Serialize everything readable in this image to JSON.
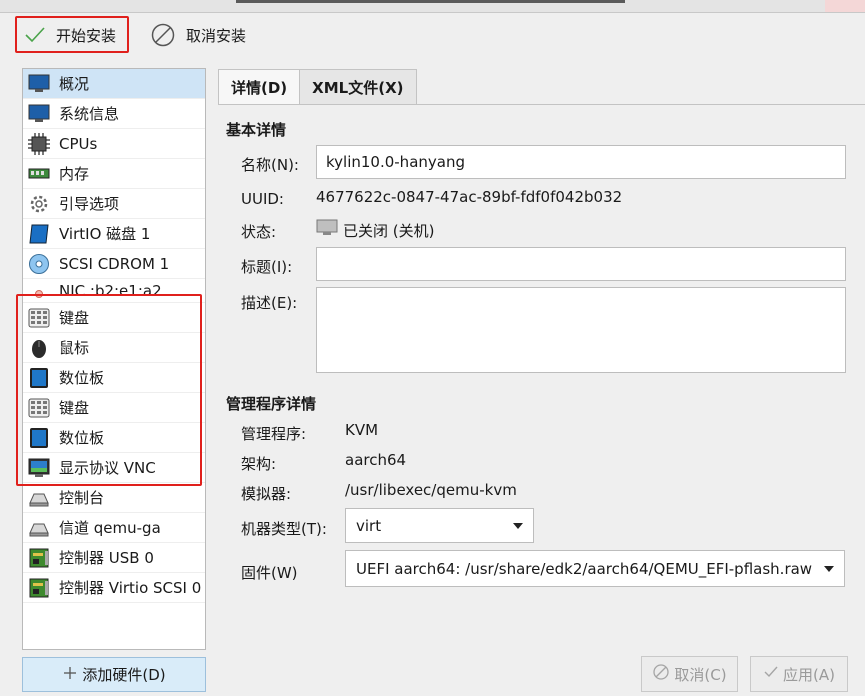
{
  "toolbar": {
    "start_install": "开始安装",
    "cancel_install": "取消安装"
  },
  "sidebar": {
    "items": [
      {
        "label": "概况",
        "icon": "monitor-icon"
      },
      {
        "label": "系统信息",
        "icon": "monitor-icon"
      },
      {
        "label": "CPUs",
        "icon": "cpu-icon"
      },
      {
        "label": "内存",
        "icon": "memory-icon"
      },
      {
        "label": "引导选项",
        "icon": "gear-icon"
      },
      {
        "label": "VirtIO 磁盘 1",
        "icon": "disk-icon"
      },
      {
        "label": "SCSI CDROM 1",
        "icon": "cdrom-icon"
      },
      {
        "label": "NIC :b2:e1:a2",
        "icon": "network-icon"
      },
      {
        "label": "键盘",
        "icon": "keyboard-icon"
      },
      {
        "label": "鼠标",
        "icon": "mouse-icon"
      },
      {
        "label": "数位板",
        "icon": "tablet-icon"
      },
      {
        "label": "键盘",
        "icon": "keyboard-icon"
      },
      {
        "label": "数位板",
        "icon": "tablet-icon"
      },
      {
        "label": "显示协议 VNC",
        "icon": "display-icon"
      },
      {
        "label": "控制台",
        "icon": "console-icon"
      },
      {
        "label": "信道 qemu-ga",
        "icon": "channel-icon"
      },
      {
        "label": "控制器 USB 0",
        "icon": "controller-icon"
      },
      {
        "label": "控制器 Virtio SCSI 0",
        "icon": "controller-icon"
      }
    ],
    "add_hardware": "添加硬件(D)"
  },
  "tabs": [
    {
      "label": "详情(D)"
    },
    {
      "label": "XML文件(X)"
    }
  ],
  "basic": {
    "title": "基本详情",
    "name_label": "名称(N):",
    "name_value": "kylin10.0-hanyang",
    "uuid_label": "UUID:",
    "uuid_value": "4677622c-0847-47ac-89bf-fdf0f042b032",
    "status_label": "状态:",
    "status_value": "已关闭 (关机)",
    "title_label": "标题(I):",
    "title_value": "",
    "desc_label": "描述(E):",
    "desc_value": ""
  },
  "hypervisor": {
    "title": "管理程序详情",
    "hv_label": "管理程序:",
    "hv_value": "KVM",
    "arch_label": "架构:",
    "arch_value": "aarch64",
    "emu_label": "模拟器:",
    "emu_value": "/usr/libexec/qemu-kvm",
    "machine_label": "机器类型(T):",
    "machine_value": "virt",
    "firmware_label": "固件(W)",
    "firmware_value": "UEFI aarch64: /usr/share/edk2/aarch64/QEMU_EFI-pflash.raw"
  },
  "footer": {
    "cancel": "取消(C)",
    "apply": "应用(A)"
  },
  "colors": {
    "highlight_red": "#e0201c",
    "selected_row": "#cfe4f6",
    "add_button_bg": "#d9ecf9"
  }
}
